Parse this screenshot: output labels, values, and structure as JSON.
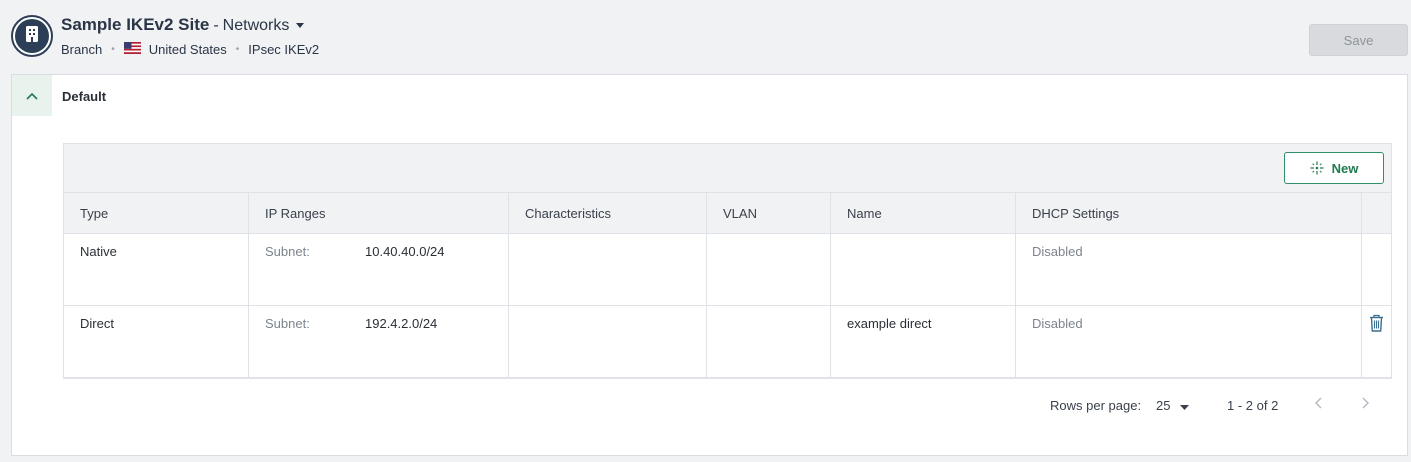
{
  "header": {
    "site_name": "Sample IKEv2 Site",
    "separator": "-",
    "section": "Networks",
    "meta": {
      "site_type": "Branch",
      "country": "United States",
      "connection": "IPsec IKEv2"
    },
    "save_label": "Save"
  },
  "group": {
    "title": "Default",
    "expanded": true
  },
  "toolbar": {
    "new_label": "New"
  },
  "table": {
    "columns": [
      "Type",
      "IP Ranges",
      "Characteristics",
      "VLAN",
      "Name",
      "DHCP Settings"
    ],
    "rows": [
      {
        "type": "Native",
        "subnet_label": "Subnet:",
        "subnet": "10.40.40.0/24",
        "characteristics": "",
        "vlan": "",
        "name": "",
        "dhcp": "Disabled",
        "deletable": false
      },
      {
        "type": "Direct",
        "subnet_label": "Subnet:",
        "subnet": "192.4.2.0/24",
        "characteristics": "",
        "vlan": "",
        "name": "example direct",
        "dhcp": "Disabled",
        "deletable": true
      }
    ]
  },
  "pagination": {
    "rows_per_page_label": "Rows per page:",
    "rows_per_page": "25",
    "range": "1 - 2 of 2"
  },
  "icons": {
    "site": "building-icon",
    "caret": "caret-down-icon",
    "flag": "us-flag-icon",
    "collapse": "chevron-up-icon",
    "new": "sparkle-icon",
    "delete": "trash-icon",
    "prev": "chevron-left-icon",
    "next": "chevron-right-icon"
  },
  "colors": {
    "accent": "#1f7a52",
    "header_bg": "#f1f2f4",
    "avatar": "#2d3f57",
    "muted_text": "#7d848d"
  }
}
